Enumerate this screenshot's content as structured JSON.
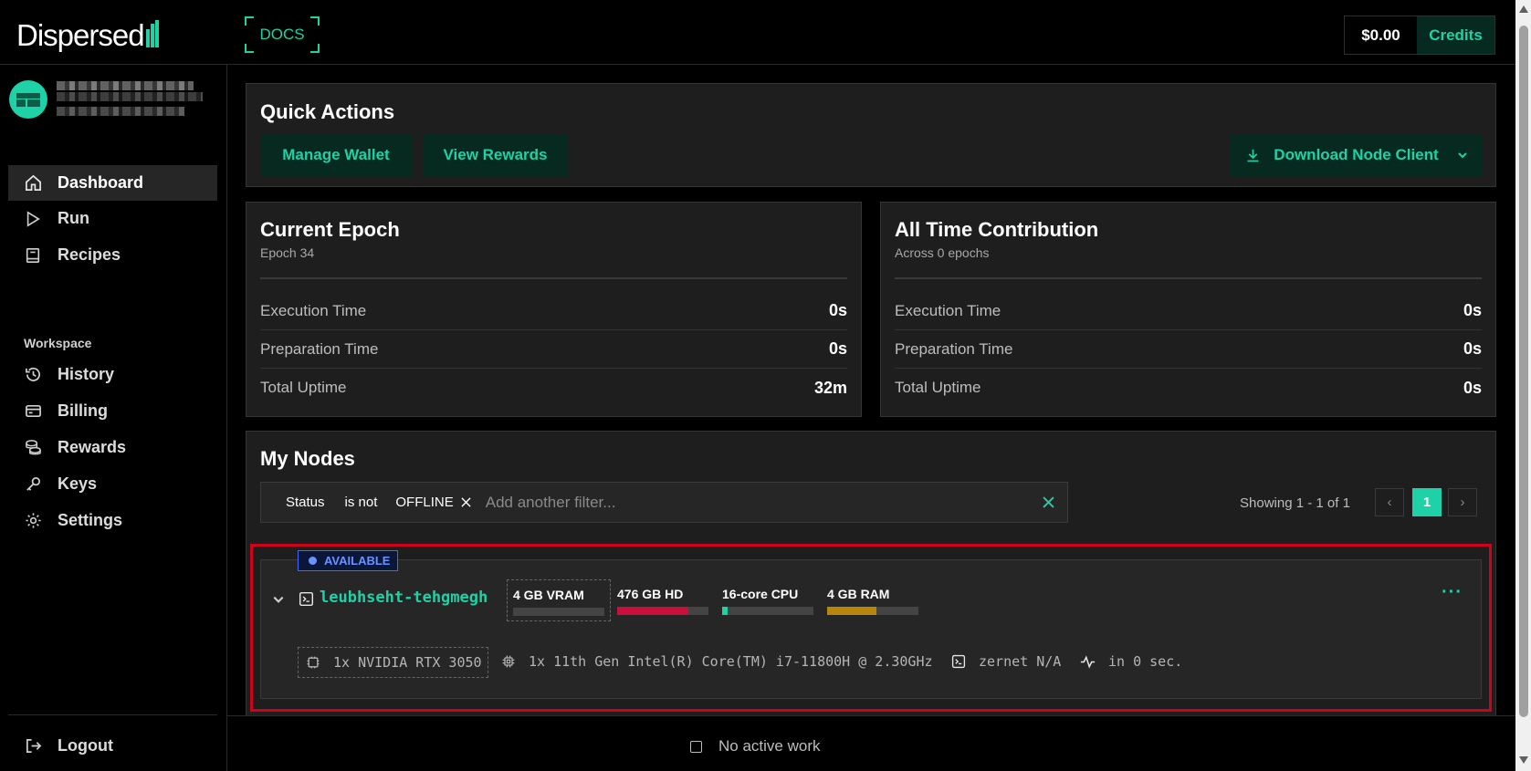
{
  "header": {
    "logo_text": "Dispersed",
    "docs_label": "DOCS",
    "balance": "$0.00",
    "credits_label": "Credits"
  },
  "sidebar": {
    "nav": [
      {
        "label": "Dashboard",
        "icon": "home-icon",
        "active": true
      },
      {
        "label": "Run",
        "icon": "play-icon"
      },
      {
        "label": "Recipes",
        "icon": "book-icon"
      }
    ],
    "workspace_label": "Workspace",
    "workspace": [
      {
        "label": "History",
        "icon": "history-icon"
      },
      {
        "label": "Billing",
        "icon": "credit-card-icon"
      },
      {
        "label": "Rewards",
        "icon": "coins-icon"
      },
      {
        "label": "Keys",
        "icon": "key-icon"
      },
      {
        "label": "Settings",
        "icon": "gear-icon"
      }
    ],
    "logout_label": "Logout"
  },
  "quick_actions": {
    "title": "Quick Actions",
    "manage_wallet": "Manage Wallet",
    "view_rewards": "View Rewards",
    "download_client": "Download Node Client"
  },
  "current_epoch": {
    "title": "Current Epoch",
    "subtitle": "Epoch 34",
    "rows": [
      {
        "label": "Execution Time",
        "value": "0s"
      },
      {
        "label": "Preparation Time",
        "value": "0s"
      },
      {
        "label": "Total Uptime",
        "value": "32m"
      }
    ]
  },
  "all_time": {
    "title": "All Time Contribution",
    "subtitle": "Across 0 epochs",
    "rows": [
      {
        "label": "Execution Time",
        "value": "0s"
      },
      {
        "label": "Preparation Time",
        "value": "0s"
      },
      {
        "label": "Total Uptime",
        "value": "0s"
      }
    ]
  },
  "my_nodes": {
    "title": "My Nodes",
    "filter": {
      "field": "Status",
      "operator": "is not",
      "value": "OFFLINE",
      "placeholder": "Add another filter..."
    },
    "pagination": {
      "showing": "Showing 1 - 1 of 1",
      "current_page": "1"
    },
    "node": {
      "status": "AVAILABLE",
      "name": "leubhseht-tehgmegh",
      "resources": [
        {
          "label": "4 GB VRAM",
          "usage": 1.0,
          "color": "#444444"
        },
        {
          "label": "476 GB HD",
          "usage": 0.78,
          "color": "#c8103b"
        },
        {
          "label": "16-core CPU",
          "usage": 0.06,
          "color": "#1fd1a6"
        },
        {
          "label": "4 GB RAM",
          "usage": 0.54,
          "color": "#b8860b"
        }
      ],
      "gpu": "1x NVIDIA RTX 3050",
      "cpu": "1x 11th Gen Intel(R) Core(TM) i7-11800H @ 2.30GHz",
      "zernet": "zernet N/A",
      "heartbeat": "in 0 sec."
    }
  },
  "footer": {
    "status": "No active work"
  },
  "colors": {
    "accent": "#1fd1a6",
    "accent_bg": "#062a20",
    "highlight": "#d0021b"
  }
}
